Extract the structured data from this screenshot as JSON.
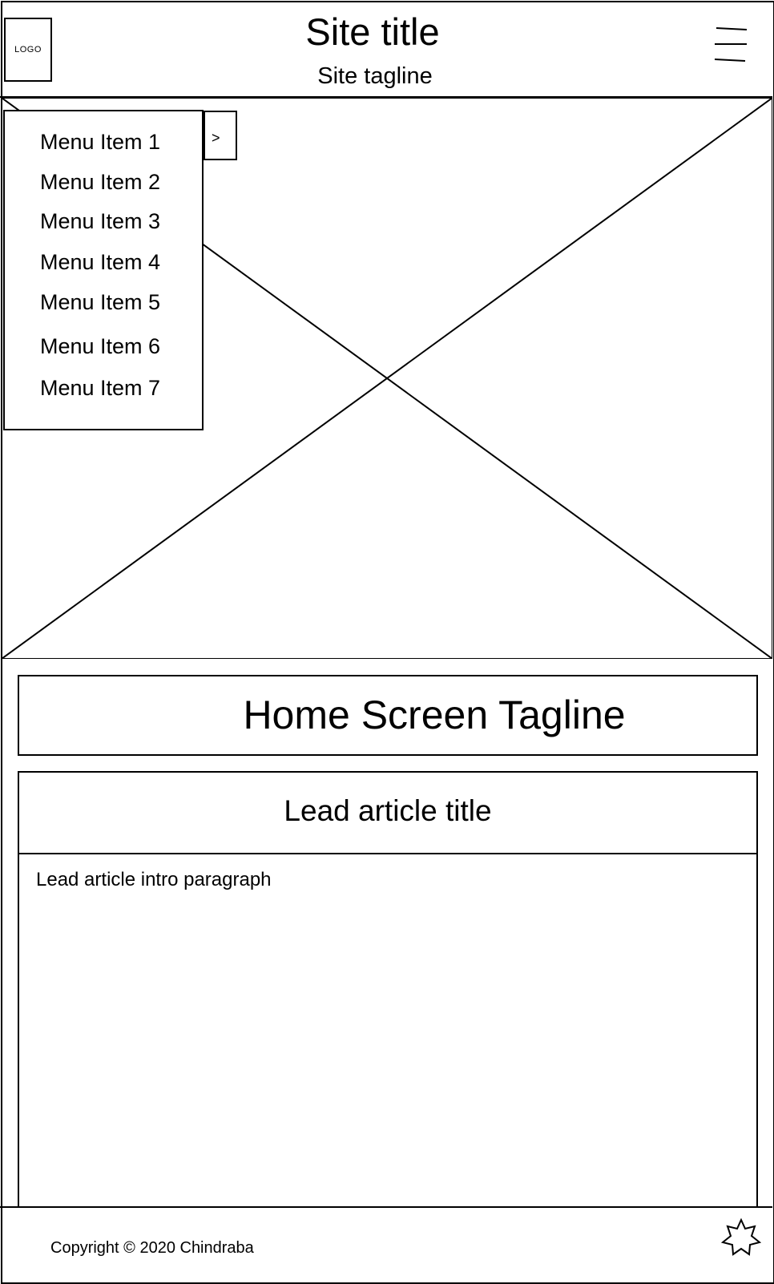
{
  "header": {
    "logo_label": "LOGO",
    "site_title": "Site title",
    "site_tagline": "Site tagline",
    "menu_icon": "hamburger-icon"
  },
  "hero": {
    "placeholder": "image-placeholder"
  },
  "menu": {
    "items": [
      {
        "label": "Menu Item 1"
      },
      {
        "label": "Menu Item 2"
      },
      {
        "label": "Menu Item 3"
      },
      {
        "label": "Menu Item 4"
      },
      {
        "label": "Menu Item 5"
      },
      {
        "label": "Menu Item 6"
      },
      {
        "label": "Menu Item 7"
      }
    ],
    "toggle_label": ">"
  },
  "main": {
    "home_tagline": "Home Screen Tagline",
    "lead_article": {
      "title": "Lead article title",
      "intro": "Lead article intro paragraph"
    }
  },
  "footer": {
    "copyright": "Copyright © 2020 Chindraba",
    "badge_icon": "star-icon"
  },
  "colors": {
    "stroke": "#000000",
    "background": "#ffffff"
  }
}
